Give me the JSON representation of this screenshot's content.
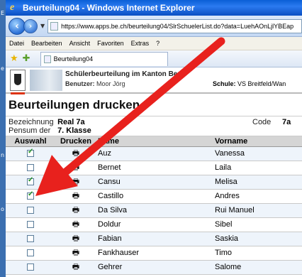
{
  "desktop_labels": [
    "E",
    "e",
    "n",
    "o"
  ],
  "window": {
    "title": "Beurteilung04 - Windows Internet Explorer",
    "address": "https://www.apps.be.ch/beurteilung04/SlrSchuelerList.do?data=LuehAOnLjlYBEap"
  },
  "menu": [
    "Datei",
    "Bearbeiten",
    "Ansicht",
    "Favoriten",
    "Extras",
    "?"
  ],
  "tab_title": "Beurteilung04",
  "app": {
    "title": "Schülerbeurteilung im Kanton Bern",
    "user_label": "Benutzer:",
    "user_value": "Moor Jörg",
    "school_label": "Schule:",
    "school_value": "VS Breitfeld/Wan"
  },
  "page_title": "Beurteilungen drucken",
  "info": {
    "bezeichnung_label": "Bezeichnung",
    "bezeichnung_value": "Real 7a",
    "pensum_label": "Pensum der",
    "pensum_value": "7. Klasse",
    "code_label": "Code",
    "code_value": "7a"
  },
  "table": {
    "headers": [
      "Auswahl",
      "Drucken",
      "Name",
      "Vorname"
    ],
    "rows": [
      {
        "name": "Auz",
        "vorname": "Vanessa",
        "checked": true
      },
      {
        "name": "Bernet",
        "vorname": "Laila",
        "checked": false
      },
      {
        "name": "Cansu",
        "vorname": "Melisa",
        "checked": true
      },
      {
        "name": "Castillo",
        "vorname": "Andres",
        "checked": true
      },
      {
        "name": "Da Silva",
        "vorname": "Rui Manuel",
        "checked": false
      },
      {
        "name": "Doldur",
        "vorname": "Sibel",
        "checked": false
      },
      {
        "name": "Fabian",
        "vorname": "Saskia",
        "checked": false
      },
      {
        "name": "Fankhauser",
        "vorname": "Timo",
        "checked": false
      },
      {
        "name": "Gehrer",
        "vorname": "Salome",
        "checked": false
      }
    ]
  },
  "colors": {
    "arrow": "#e8211d",
    "titlebar": "#0a5fd6"
  }
}
